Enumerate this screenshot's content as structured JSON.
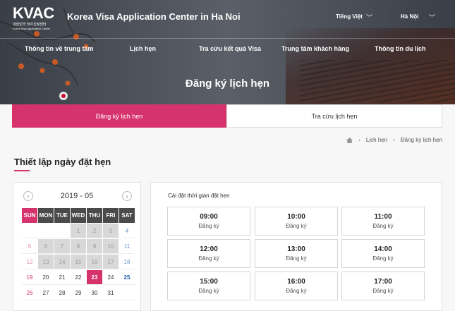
{
  "header": {
    "logo_text": "KVAC",
    "logo_sub_korean": "대한민국 비자신청센터",
    "logo_sub_english": "Korea Visa Application Center",
    "site_title": "Korea Visa Application Center in Ha Noi",
    "language": "Tiếng Việt",
    "city": "Hà Nội"
  },
  "nav": {
    "items": [
      {
        "label": "Thông tin về trung tâm"
      },
      {
        "label": "Lịch hẹn"
      },
      {
        "label": "Tra cứu kết quả Visa"
      },
      {
        "label": "Trung tâm khách hàng"
      },
      {
        "label": "Thông tin du lịch"
      }
    ]
  },
  "hero": {
    "title": "Đăng ký lịch hẹn"
  },
  "tabs": [
    {
      "label": "Đăng ký lịch hẹn",
      "active": true
    },
    {
      "label": "Tra cứu lịch hẹn",
      "active": false
    }
  ],
  "breadcrumb": {
    "items": [
      "Lịch hẹn",
      "Đăng ký lịch hẹn"
    ]
  },
  "section": {
    "title": "Thiết lập ngày đặt hẹn"
  },
  "calendar": {
    "month_label": "2019 - 05",
    "weekdays": [
      "SUN",
      "MON",
      "TUE",
      "WED",
      "THU",
      "FRI",
      "SAT"
    ],
    "weeks": [
      [
        "",
        "",
        "1",
        "2",
        "3",
        "4"
      ],
      [
        "5",
        "6",
        "7",
        "8",
        "9",
        "10",
        "11"
      ],
      [
        "12",
        "13",
        "14",
        "15",
        "16",
        "17",
        "18"
      ],
      [
        "19",
        "20",
        "21",
        "22",
        "23",
        "24",
        "25"
      ],
      [
        "26",
        "27",
        "28",
        "29",
        "30",
        "31",
        ""
      ]
    ],
    "selected_day": "23"
  },
  "time_panel": {
    "title": "Cài đặt thời gian đặt hẹn",
    "slots": [
      {
        "time": "09:00",
        "action": "Đăng ký"
      },
      {
        "time": "10:00",
        "action": "Đăng ký"
      },
      {
        "time": "11:00",
        "action": "Đăng ký"
      },
      {
        "time": "12:00",
        "action": "Đăng ký"
      },
      {
        "time": "13:00",
        "action": "Đăng ký"
      },
      {
        "time": "14:00",
        "action": "Đăng ký"
      },
      {
        "time": "15:00",
        "action": "Đăng ký"
      },
      {
        "time": "16:00",
        "action": "Đăng ký"
      },
      {
        "time": "17:00",
        "action": "Đăng ký"
      }
    ]
  },
  "colors": {
    "accent": "#d6336c",
    "header_dark": "#4a4a4a",
    "saturday": "#1f5fa8"
  }
}
